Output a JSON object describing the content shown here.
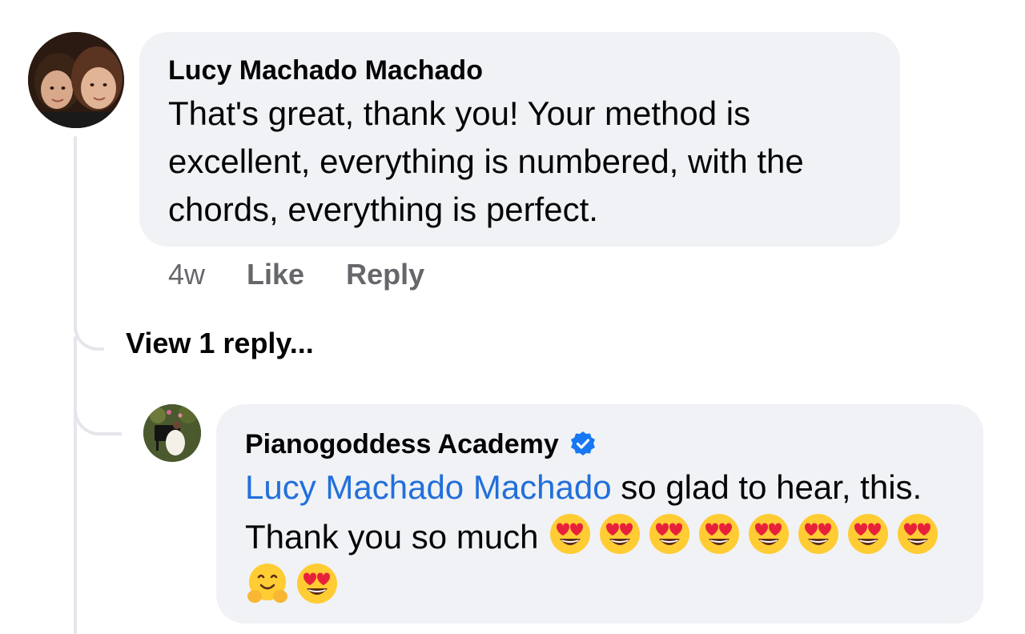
{
  "comment": {
    "author": "Lucy Machado Machado",
    "text": "That's great, thank you! Your method is excellent, everything is numbered, with the chords, everything is perfect.",
    "time": "4w",
    "like_label": "Like",
    "reply_label": "Reply"
  },
  "view_replies_label": "View 1 reply...",
  "reply": {
    "author": "Pianogoddess Academy",
    "verified_icon": "verified-badge-icon",
    "mention": "Lucy Machado Machado",
    "text": " so glad to hear, this. Thank you so much ",
    "emojis": [
      "heart-eyes-emoji",
      "heart-eyes-emoji",
      "heart-eyes-emoji",
      "heart-eyes-emoji",
      "heart-eyes-emoji",
      "heart-eyes-emoji",
      "heart-eyes-emoji",
      "heart-eyes-emoji",
      "hugging-face-emoji",
      "heart-eyes-emoji"
    ]
  },
  "colors": {
    "bubble": "#f0f2f5",
    "mention": "#216fdb",
    "verified": "#1877f2",
    "muted_text": "#65676b"
  }
}
